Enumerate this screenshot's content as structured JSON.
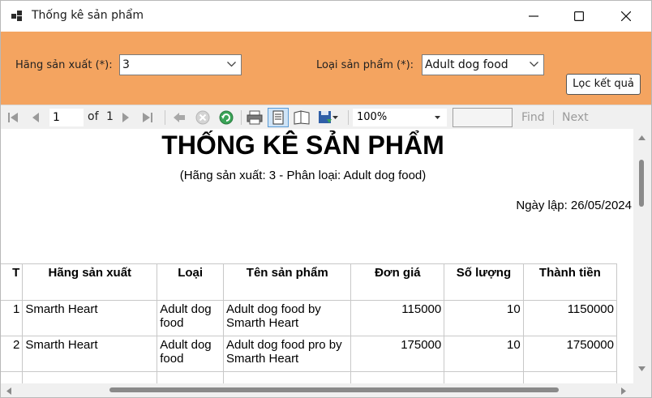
{
  "window": {
    "title": "Thống kê sản phẩm"
  },
  "filter": {
    "manufacturer_label": "Hãng sản xuất (*):",
    "manufacturer_value": "3",
    "category_label": "Loại sản phẩm (*):",
    "category_value": "Adult dog food",
    "button_label": "Lọc kết quả",
    "background_color": "#f4a460"
  },
  "toolbar": {
    "page_current": "1",
    "page_of": "of",
    "page_total": "1",
    "zoom": "100%",
    "find_label": "Find",
    "next_label": "Next"
  },
  "report": {
    "title": "THỐNG KÊ SẢN PHẨM",
    "subtitle": "(Hãng sản xuất: 3 - Phân loại: Adult dog food)",
    "date_line": "Ngày lập: 26/05/2024",
    "columns": [
      "T",
      "Hãng sản xuất",
      "Loại",
      "Tên sản phẩm",
      "Đơn giá",
      "Số lượng",
      "Thành tiền"
    ],
    "rows": [
      {
        "stt": "1",
        "manufacturer": "Smarth Heart",
        "type": "Adult dog food",
        "name": "Adult dog food by Smarth Heart",
        "price": "115000",
        "qty": "10",
        "total": "1150000"
      },
      {
        "stt": "2",
        "manufacturer": "Smarth Heart",
        "type": "Adult dog food",
        "name": "Adult dog food pro by Smarth Heart",
        "price": "175000",
        "qty": "10",
        "total": "1750000"
      }
    ]
  }
}
